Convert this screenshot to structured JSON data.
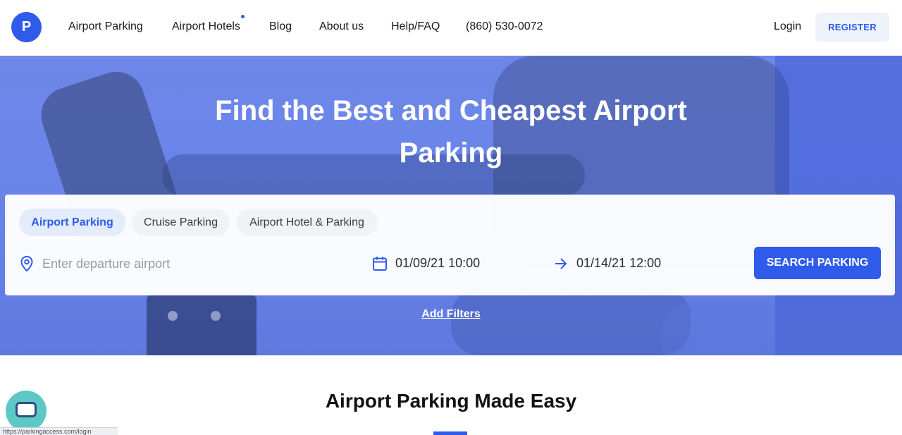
{
  "header": {
    "logo_letter": "P",
    "nav": [
      "Airport Parking",
      "Airport Hotels",
      "Blog",
      "About us",
      "Help/FAQ",
      "(860) 530-0072"
    ],
    "login_label": "Login",
    "register_label": "REGISTER"
  },
  "hero": {
    "headline": "Find the Best and Cheapest Airport Parking",
    "add_filters_label": "Add Filters"
  },
  "search": {
    "tabs": [
      "Airport Parking",
      "Cruise Parking",
      "Airport Hotel & Parking"
    ],
    "active_tab": "Airport Parking",
    "airport_placeholder": "Enter departure airport",
    "airport_value": "",
    "start_datetime": "01/09/21 10:00",
    "end_datetime": "01/14/21 12:00",
    "search_button_label": "SEARCH PARKING"
  },
  "section": {
    "title": "Airport Parking Made Easy"
  },
  "status_bar": {
    "text": "https://parkingaccess.com/login"
  },
  "colors": {
    "brand": "#2f5bea",
    "chat": "#5ec8c6"
  }
}
